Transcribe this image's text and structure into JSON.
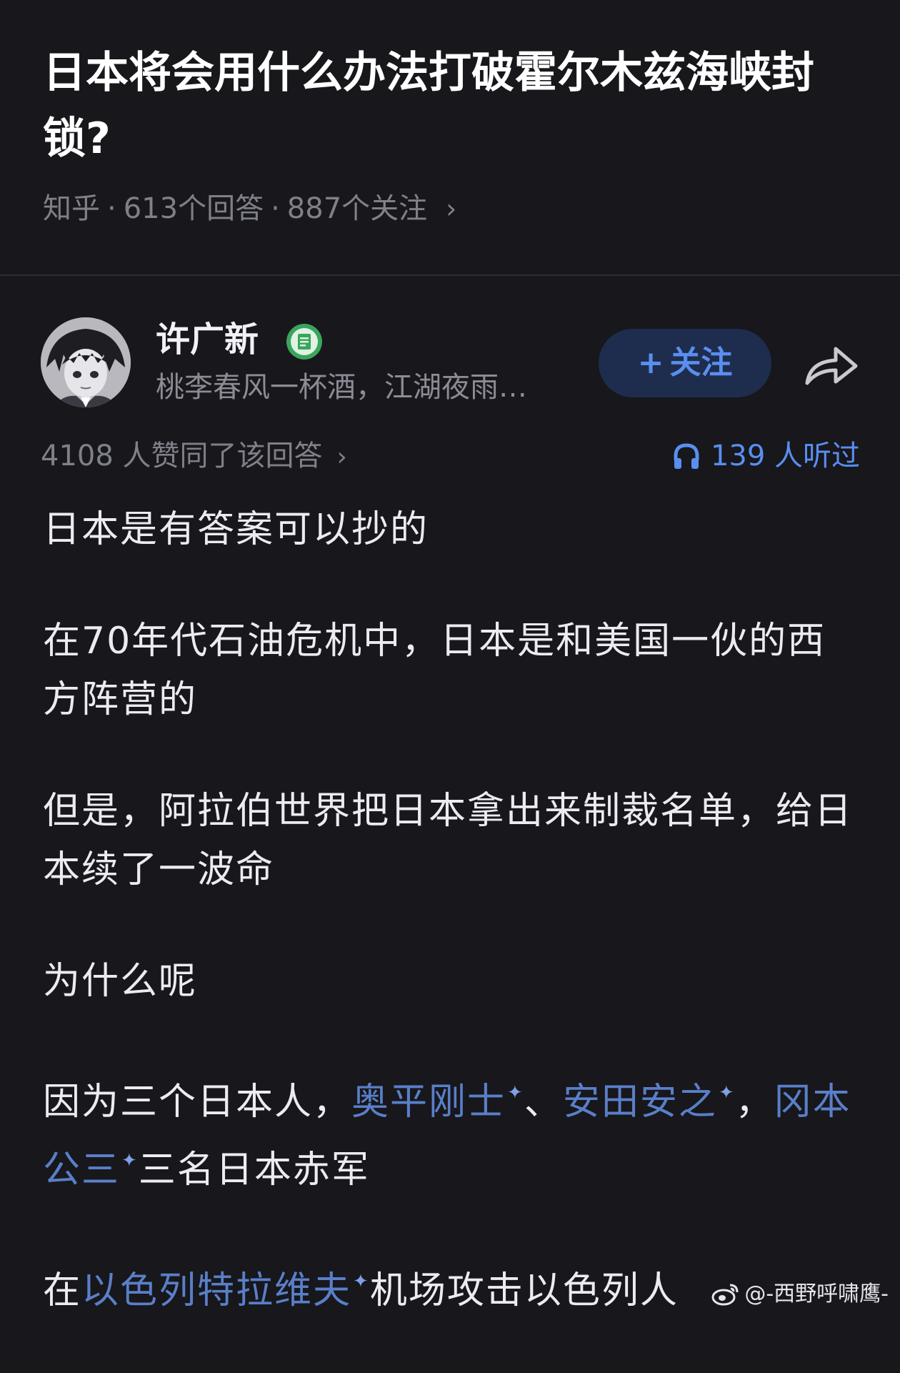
{
  "question": {
    "title": "日本将会用什么办法打破霍尔木兹海峡封锁?",
    "source": "知乎",
    "answers": "613个回答",
    "follows": "887个关注",
    "separator": "·",
    "chevron": "›"
  },
  "author": {
    "name": "许广新",
    "bio": "桃李春风一杯酒，江湖夜雨…",
    "badge_icon": "certified-badge-icon",
    "follow_plus": "+",
    "follow_label": "关注",
    "share_icon": "share-arrow-icon"
  },
  "stats": {
    "approvals": "4108 人赞同了该回答",
    "chevron": "›",
    "listened": "139 人听过",
    "listen_icon": "headphones-icon"
  },
  "content": {
    "p1": "日本是有答案可以抄的",
    "p2": "在70年代石油危机中，日本是和美国一伙的西方阵营的",
    "p3": "但是，阿拉伯世界把日本拿出来制裁名单，给日本续了一波命",
    "p4": "为什么呢",
    "p5": {
      "prefix": "因为三个日本人，",
      "link1": "奥平刚士",
      "sep1": "、",
      "link2": "安田安之",
      "sep2": "，",
      "link3": "冈本公三",
      "suffix": "三名日本赤军"
    },
    "p6": {
      "prefix": "在",
      "link": "以色列特拉维夫",
      "suffix": "机场攻击以色列人"
    },
    "spark": "✦"
  },
  "watermark": {
    "text": "@-西野呼啸鹰-",
    "icon": "weibo-logo-icon"
  },
  "colors": {
    "background": "#17171c",
    "link": "#5a7fc8",
    "accent": "#5a8ef0",
    "meta": "#7f8088",
    "badge": "#3aa55c"
  }
}
